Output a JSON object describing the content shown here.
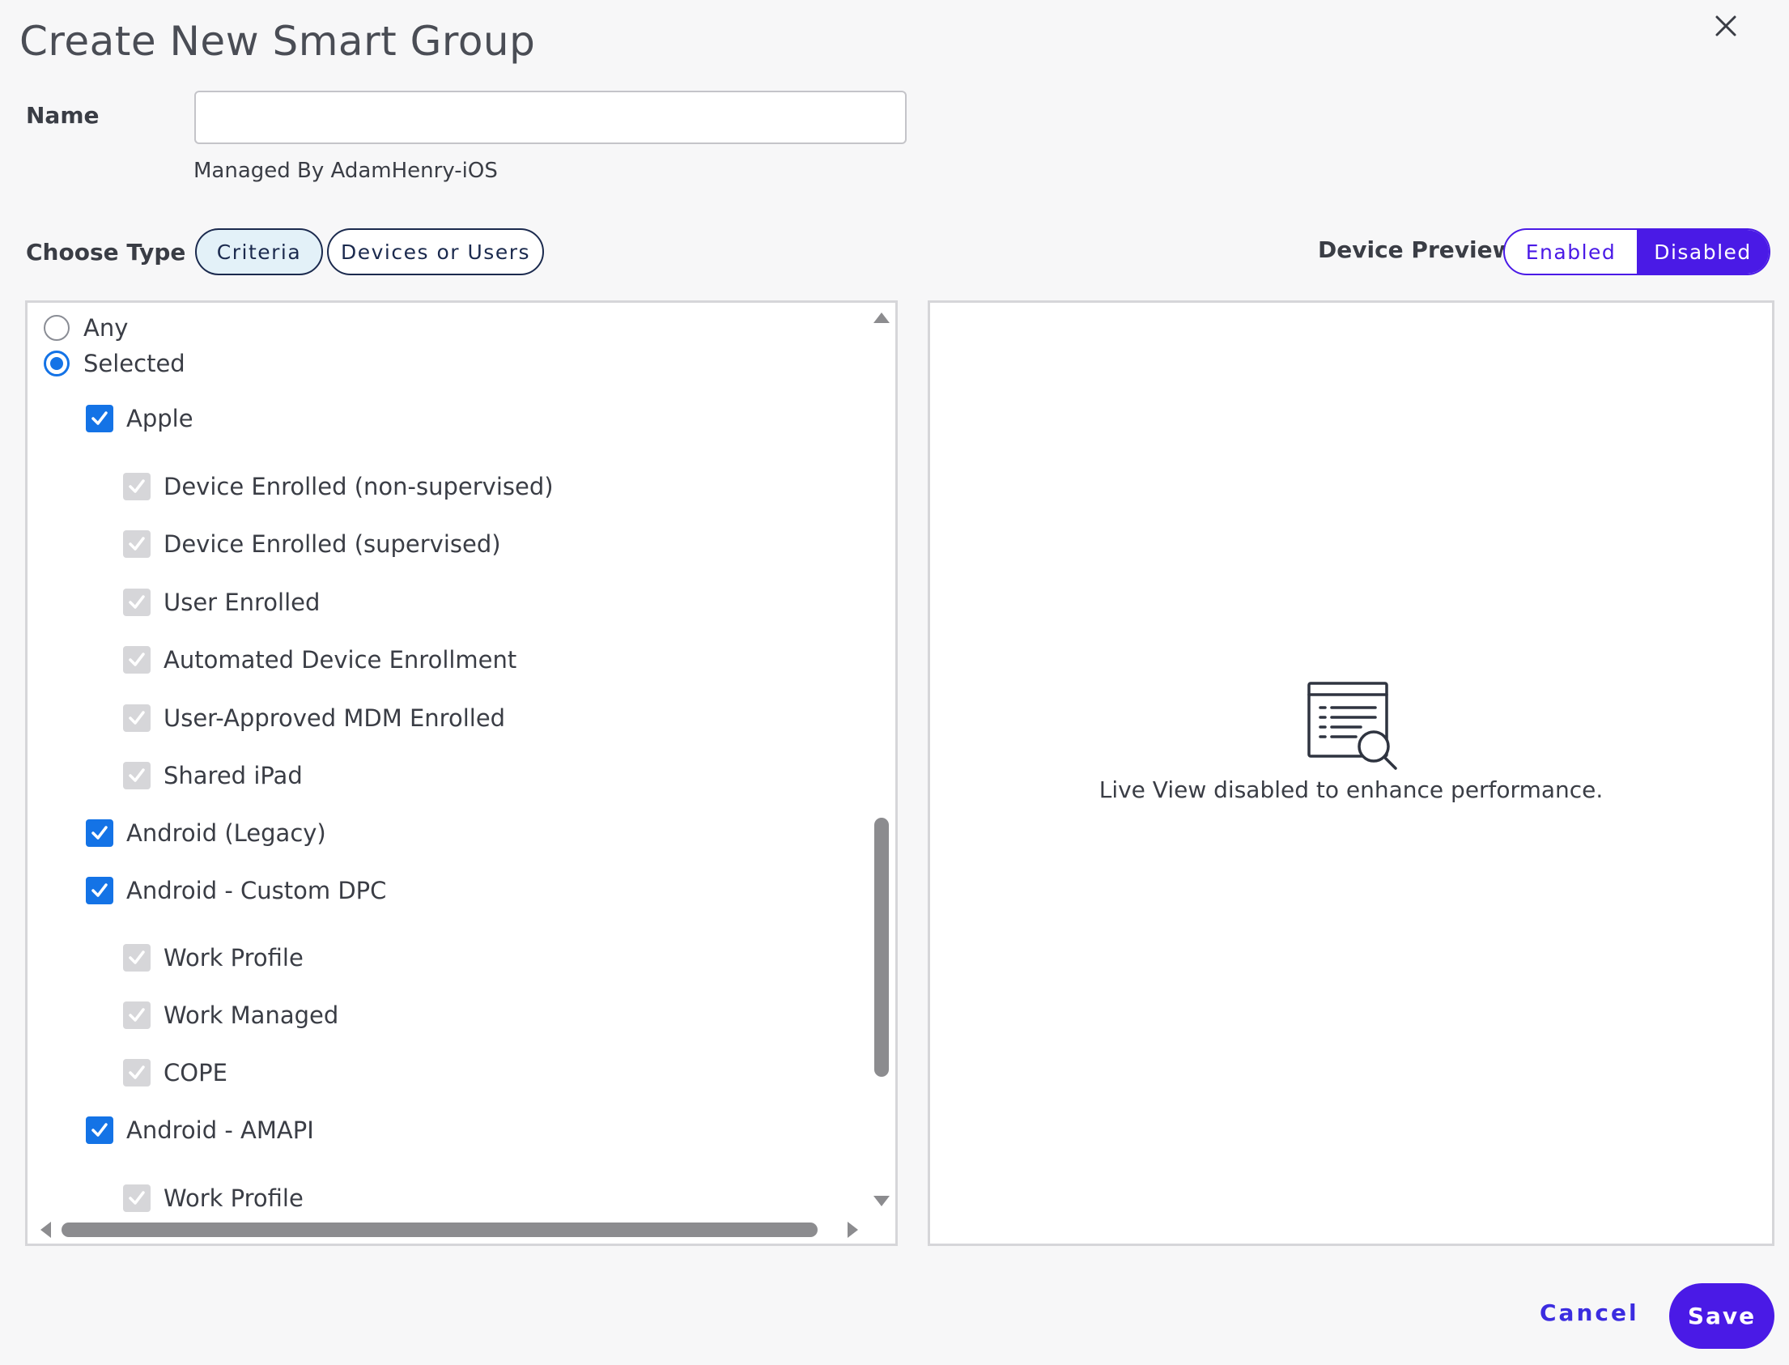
{
  "dialog": {
    "title": "Create New Smart Group",
    "close_icon": "close-icon"
  },
  "name_field": {
    "label": "Name",
    "value": "",
    "placeholder": ""
  },
  "managed_by": "Managed By AdamHenry-iOS",
  "choose_type": {
    "label": "Choose Type",
    "options": [
      "Criteria",
      "Devices or Users"
    ],
    "selected": "Criteria"
  },
  "device_preview": {
    "label": "Device Preview",
    "options": [
      "Enabled",
      "Disabled"
    ],
    "selected": "Disabled"
  },
  "criteria": {
    "radios": [
      {
        "label": "Any",
        "checked": false
      },
      {
        "label": "Selected",
        "checked": true
      }
    ],
    "groups": [
      {
        "label": "Apple",
        "checked": true,
        "children": [
          "Device Enrolled (non-supervised)",
          "Device Enrolled (supervised)",
          "User Enrolled",
          "Automated Device Enrollment",
          "User-Approved MDM Enrolled",
          "Shared iPad"
        ]
      },
      {
        "label": "Android (Legacy)",
        "checked": true,
        "children": []
      },
      {
        "label": "Android - Custom DPC",
        "checked": true,
        "children": [
          "Work Profile",
          "Work Managed",
          "COPE"
        ]
      },
      {
        "label": "Android - AMAPI",
        "checked": true,
        "children": [
          "Work Profile"
        ]
      }
    ]
  },
  "preview": {
    "message": "Live View disabled to enhance performance.",
    "icon": "document-search-icon"
  },
  "footer": {
    "cancel_label": "Cancel",
    "save_label": "Save"
  },
  "colors": {
    "accent": "#4a1ae6",
    "checkbox": "#1473e6",
    "disabled_checkbox": "#d6d6d9"
  }
}
